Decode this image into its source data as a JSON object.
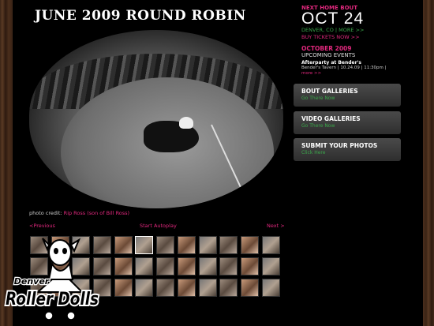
{
  "gallery": {
    "title": "JUNE 2009 ROUND ROBIN",
    "credit_prefix": "photo credit:",
    "credit_name": "Rip Ross (son of Bill Ross)",
    "prev_label": "<Previous",
    "autoplay_label": "Start Autoplay",
    "next_label": "Next >",
    "thumbnail_count": 36,
    "selected_thumbnail_index": 5
  },
  "next_bout": {
    "label": "NEXT HOME BOUT",
    "date": "OCT 24",
    "location": "DENVER, CO",
    "more_label": "MORE >>",
    "tickets_label": "BUY TICKETS NOW >>"
  },
  "events": {
    "month": "OCTOBER 2009",
    "label": "UPCOMING EVENTS",
    "title": "Afterparty at Bender's",
    "detail": "Bender's Tavern | 10.24.09 | 11:30pm |",
    "more_label": "more >>"
  },
  "sidebar_buttons": [
    {
      "title": "BOUT GALLERIES",
      "subtitle": "Go There Now"
    },
    {
      "title": "VIDEO GALLERIES",
      "subtitle": "Go There Now"
    },
    {
      "title": "SUBMIT YOUR PHOTOS",
      "subtitle": "Click Here"
    }
  ],
  "logo": {
    "top_text": "Denver",
    "main_text": "Roller Dolls"
  },
  "colors": {
    "accent_pink": "#e2287e",
    "accent_green": "#3aa64a",
    "panel_bg": "#000000"
  }
}
